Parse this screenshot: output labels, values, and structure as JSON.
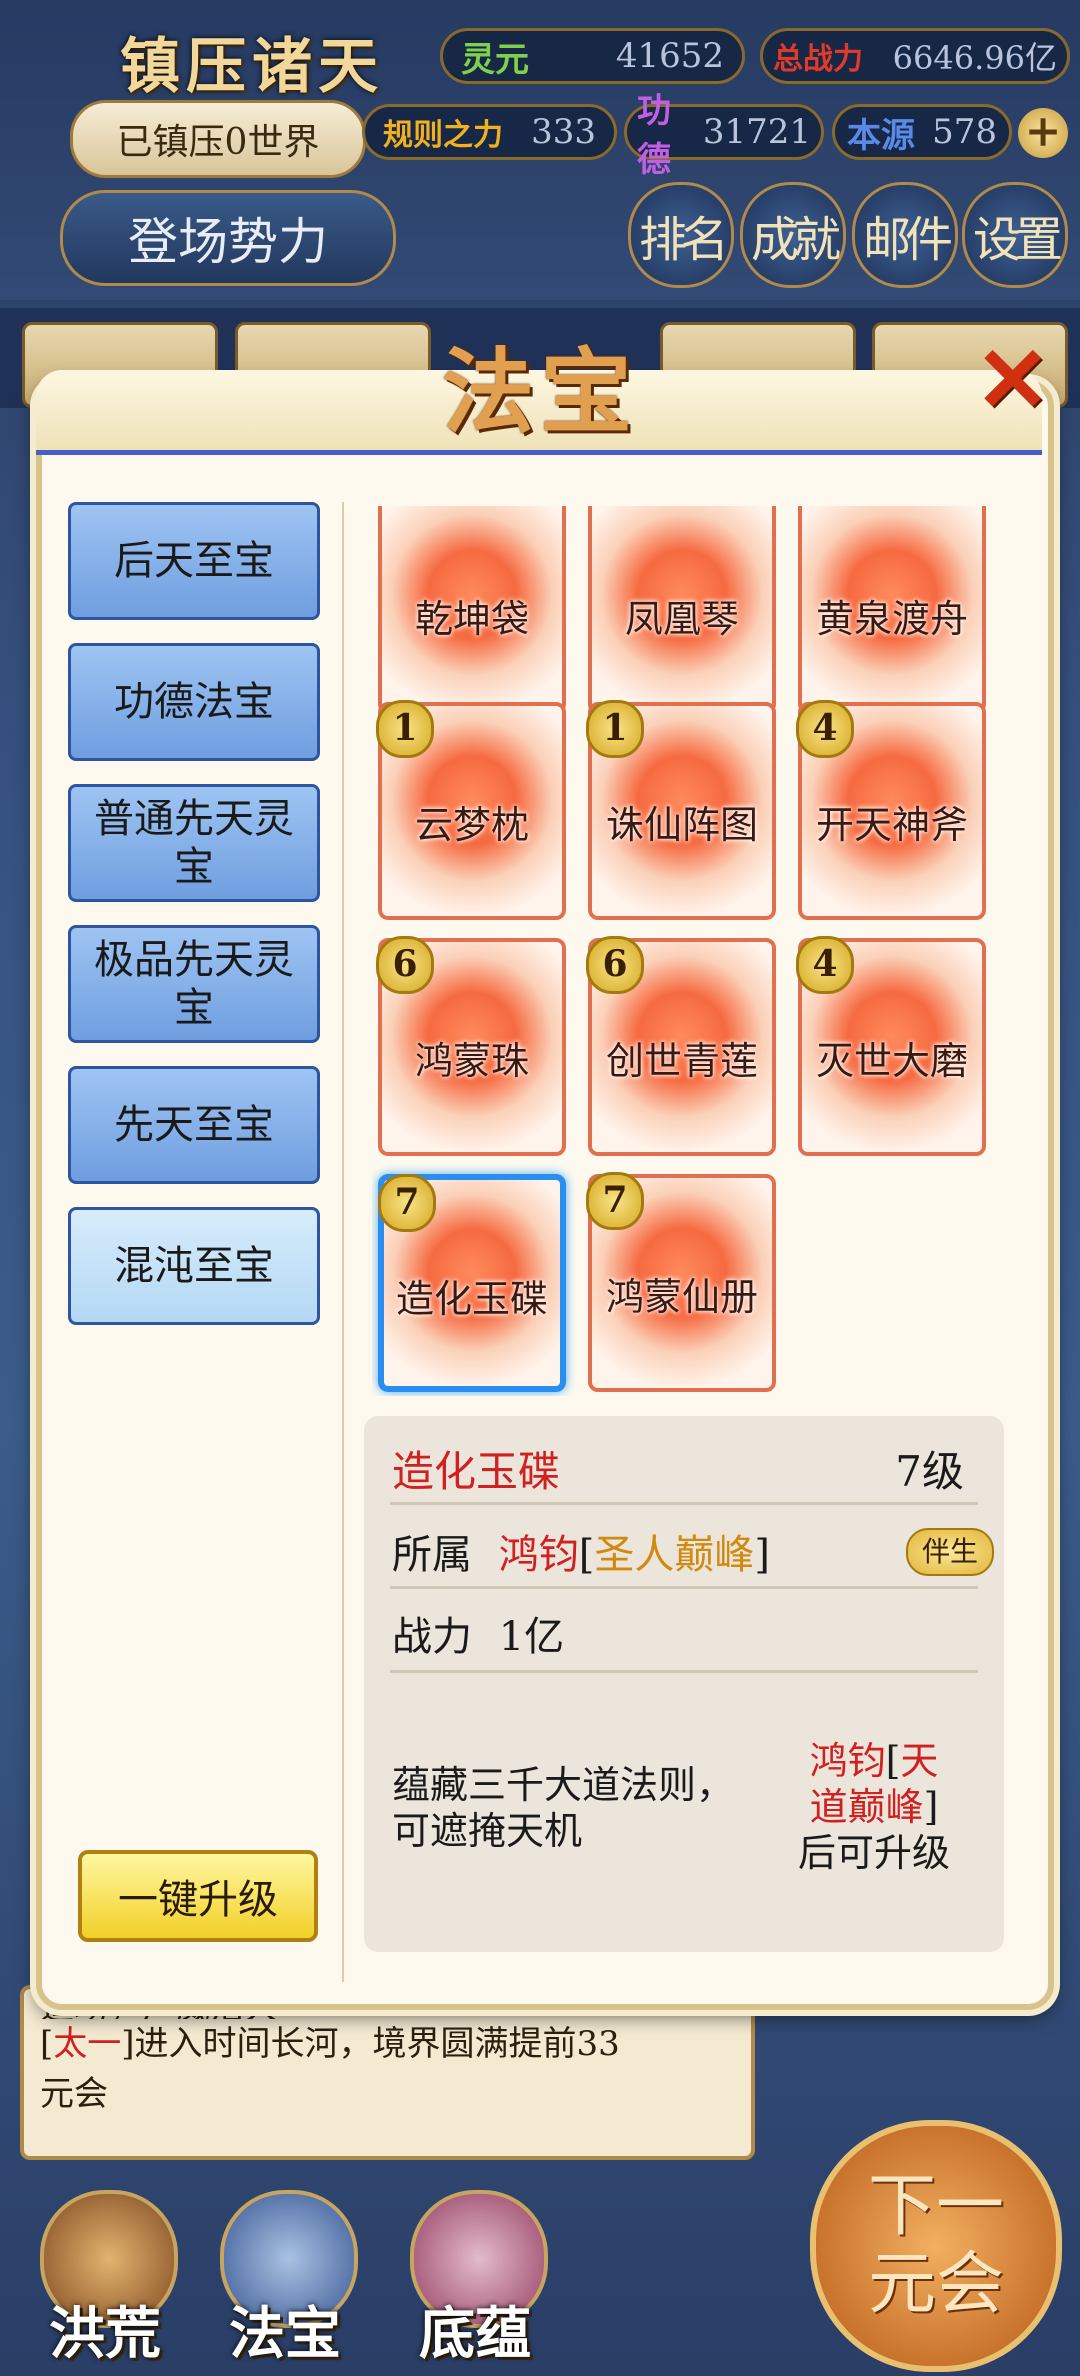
{
  "hud": {
    "game_title": "镇压诸天",
    "world_status": "已镇压0世界",
    "entry_button": "登场势力",
    "stats": {
      "lingyuan": {
        "label": "灵元",
        "value": "41652"
      },
      "total_power": {
        "label": "总战力",
        "value": "6646.96亿"
      },
      "rule_power": {
        "label": "规则之力",
        "value": "333"
      },
      "merit": {
        "label": "功德",
        "value": "31721"
      },
      "origin": {
        "label": "本源",
        "value": "578"
      }
    },
    "plus_label": "+",
    "buttons": {
      "rank": "排名",
      "achievement": "成就",
      "mail": "邮件",
      "settings": "设置"
    }
  },
  "modal": {
    "title": "法宝",
    "close_label": "✕",
    "categories": [
      {
        "label": "后天至宝"
      },
      {
        "label": "功德法宝"
      },
      {
        "label": "普通先天灵宝"
      },
      {
        "label": "极品先天灵宝"
      },
      {
        "label": "先天至宝"
      },
      {
        "label": "混沌至宝"
      }
    ],
    "upgrade_all": "一键升级",
    "treasures": [
      {
        "name": "乾坤袋",
        "level": ""
      },
      {
        "name": "凤凰琴",
        "level": ""
      },
      {
        "name": "黄泉渡舟",
        "level": ""
      },
      {
        "name": "云梦枕",
        "level": "1"
      },
      {
        "name": "诛仙阵图",
        "level": "1"
      },
      {
        "name": "开天神斧",
        "level": "4"
      },
      {
        "name": "鸿蒙珠",
        "level": "6"
      },
      {
        "name": "创世青莲",
        "level": "6"
      },
      {
        "name": "灭世大磨",
        "level": "4"
      },
      {
        "name": "造化玉碟",
        "level": "7"
      },
      {
        "name": "鸿蒙仙册",
        "level": "7"
      }
    ],
    "detail": {
      "name": "造化玉碟",
      "level": "7级",
      "owner_label": "所属",
      "owner": "鸿钧",
      "bracket_open": "[",
      "owner_rank": "圣人巅峰",
      "bracket_close": "]",
      "badge": "伴生",
      "power_label": "战力",
      "power_value": "1亿",
      "description_1": "蕴藏三千大道法则，",
      "description_2": "可遮掩天机",
      "req_owner": "鸿钧",
      "req_rank_1": "天",
      "req_rank_2": "道巅峰",
      "req_suffix": "后可升级"
    }
  },
  "log": {
    "prev_line": "道场，声威浩大",
    "name": "太一",
    "message_1": "进入时间长河，境界圆满提前33",
    "message_2": "元会"
  },
  "bottom_nav": {
    "honghuang": "洪荒",
    "fabao": "法宝",
    "diyun": "底蕴",
    "next_1": "下一",
    "next_2": "元会"
  }
}
